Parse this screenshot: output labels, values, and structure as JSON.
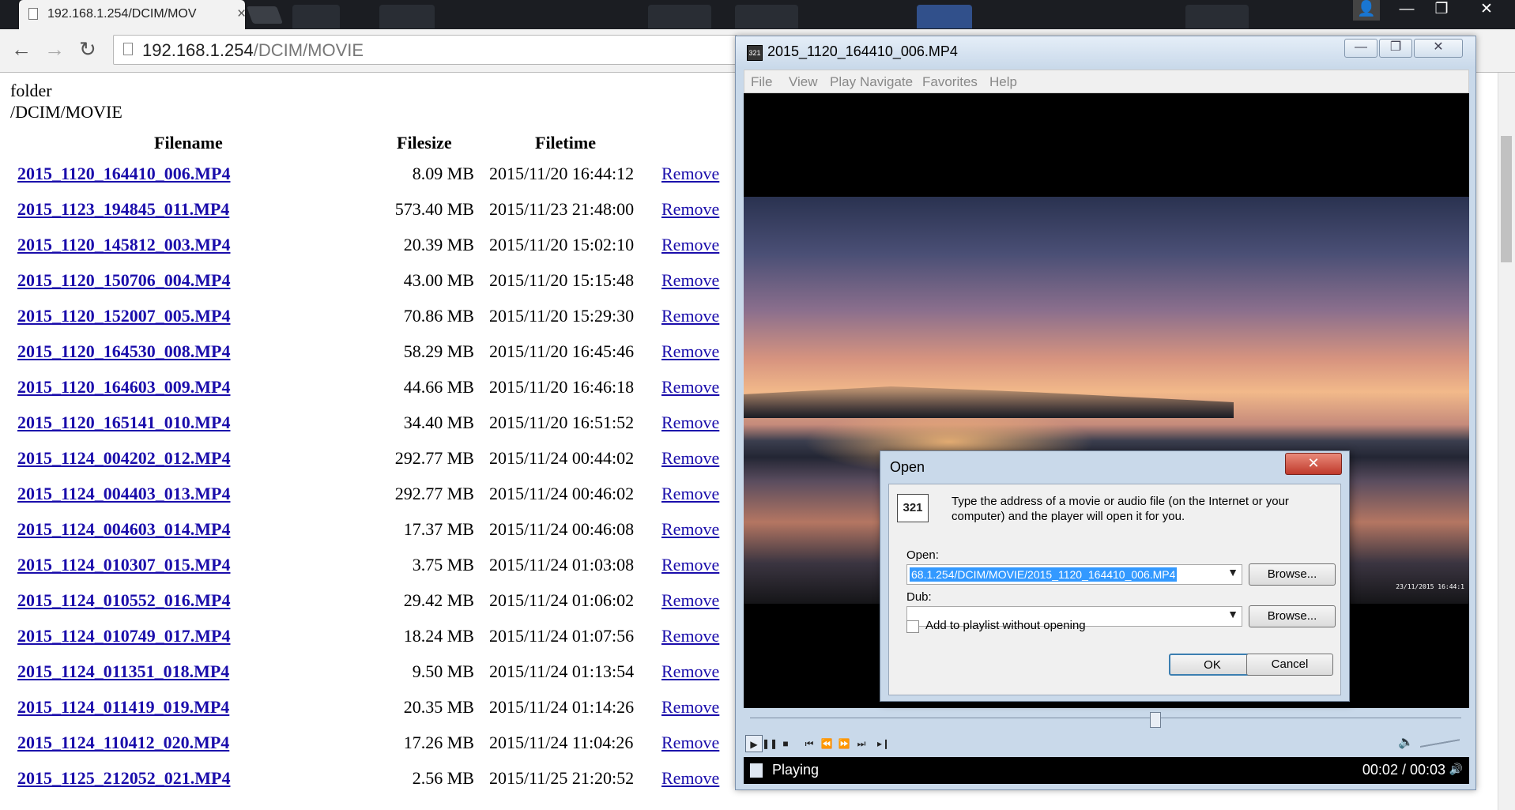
{
  "browser": {
    "tab_title": "192.168.1.254/DCIM/MOV",
    "tab_close": "×",
    "url_host": "192.168.1.254",
    "url_path": "/DCIM/MOVIE",
    "back": "←",
    "forward": "→",
    "reload": "↻",
    "window_controls": {
      "minimize": "—",
      "maximize": "❐",
      "close": "✕"
    }
  },
  "page": {
    "folder_label": "folder",
    "folder_path": "/DCIM/MOVIE",
    "columns": {
      "filename": "Filename",
      "filesize": "Filesize",
      "filetime": "Filetime"
    },
    "remove_label": "Remove",
    "rows": [
      {
        "name": "2015_1120_164410_006.MP4",
        "size": "8.09 MB",
        "time": "2015/11/20 16:44:12"
      },
      {
        "name": "2015_1123_194845_011.MP4",
        "size": "573.40 MB",
        "time": "2015/11/23 21:48:00"
      },
      {
        "name": "2015_1120_145812_003.MP4",
        "size": "20.39 MB",
        "time": "2015/11/20 15:02:10"
      },
      {
        "name": "2015_1120_150706_004.MP4",
        "size": "43.00 MB",
        "time": "2015/11/20 15:15:48"
      },
      {
        "name": "2015_1120_152007_005.MP4",
        "size": "70.86 MB",
        "time": "2015/11/20 15:29:30"
      },
      {
        "name": "2015_1120_164530_008.MP4",
        "size": "58.29 MB",
        "time": "2015/11/20 16:45:46"
      },
      {
        "name": "2015_1120_164603_009.MP4",
        "size": "44.66 MB",
        "time": "2015/11/20 16:46:18"
      },
      {
        "name": "2015_1120_165141_010.MP4",
        "size": "34.40 MB",
        "time": "2015/11/20 16:51:52"
      },
      {
        "name": "2015_1124_004202_012.MP4",
        "size": "292.77 MB",
        "time": "2015/11/24 00:44:02"
      },
      {
        "name": "2015_1124_004403_013.MP4",
        "size": "292.77 MB",
        "time": "2015/11/24 00:46:02"
      },
      {
        "name": "2015_1124_004603_014.MP4",
        "size": "17.37 MB",
        "time": "2015/11/24 00:46:08"
      },
      {
        "name": "2015_1124_010307_015.MP4",
        "size": "3.75 MB",
        "time": "2015/11/24 01:03:08"
      },
      {
        "name": "2015_1124_010552_016.MP4",
        "size": "29.42 MB",
        "time": "2015/11/24 01:06:02"
      },
      {
        "name": "2015_1124_010749_017.MP4",
        "size": "18.24 MB",
        "time": "2015/11/24 01:07:56"
      },
      {
        "name": "2015_1124_011351_018.MP4",
        "size": "9.50 MB",
        "time": "2015/11/24 01:13:54"
      },
      {
        "name": "2015_1124_011419_019.MP4",
        "size": "20.35 MB",
        "time": "2015/11/24 01:14:26"
      },
      {
        "name": "2015_1124_110412_020.MP4",
        "size": "17.26 MB",
        "time": "2015/11/24 11:04:26"
      },
      {
        "name": "2015_1125_212052_021.MP4",
        "size": "2.56 MB",
        "time": "2015/11/25 21:20:52"
      }
    ]
  },
  "player": {
    "title": "2015_1120_164410_006.MP4",
    "app_icon": "321",
    "menu": [
      "File",
      "View",
      "Play",
      "Navigate",
      "Favorites",
      "Help"
    ],
    "window_controls": {
      "minimize": "—",
      "maximize": "❐",
      "close": "✕"
    },
    "video_stamp": "23/11/2015 16:44:1",
    "seek_position_fraction": 0.57,
    "status": "Playing",
    "time": "00:02 / 00:03",
    "icons": {
      "play": "play-icon",
      "pause": "pause-icon",
      "stop": "stop-icon",
      "volume": "speaker-icon"
    }
  },
  "open_dialog": {
    "title": "Open",
    "close": "✕",
    "icon_text": "321",
    "message": "Type the address of a movie or audio file (on the Internet or your computer) and the player will open it for you.",
    "open_label": "Open:",
    "open_value": "68.1.254/DCIM/MOVIE/2015_1120_164410_006.MP4",
    "dub_label": "Dub:",
    "dub_value": "",
    "browse_label": "Browse...",
    "checkbox_label": "Add to playlist without opening",
    "checkbox_checked": false,
    "ok_label": "OK",
    "cancel_label": "Cancel"
  }
}
